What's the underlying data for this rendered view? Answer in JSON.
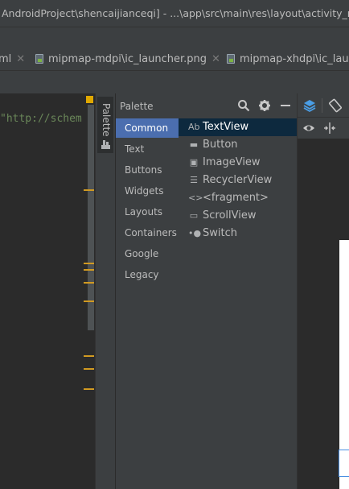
{
  "window": {
    "title": "AndroidProject\\shencaijianceqi] - ...\\app\\src\\main\\res\\layout\\activity_m"
  },
  "tabs": [
    {
      "label": "ml",
      "closable": true
    },
    {
      "label": "mipmap-mdpi\\ic_launcher.png",
      "closable": true
    },
    {
      "label": "mipmap-xhdpi\\ic_launc"
    }
  ],
  "editor": {
    "code_line": "\"http://schem"
  },
  "side_strip": {
    "palette_tab_label": "Palette"
  },
  "palette": {
    "title": "Palette",
    "categories": [
      {
        "label": "Common",
        "selected": true
      },
      {
        "label": "Text"
      },
      {
        "label": "Buttons"
      },
      {
        "label": "Widgets"
      },
      {
        "label": "Layouts"
      },
      {
        "label": "Containers"
      },
      {
        "label": "Google"
      },
      {
        "label": "Legacy"
      }
    ],
    "items": [
      {
        "icon": "Ab",
        "icon_name": "textview-icon",
        "label": "TextView",
        "selected": true
      },
      {
        "icon": "▬",
        "icon_name": "button-icon",
        "label": "Button"
      },
      {
        "icon": "▣",
        "icon_name": "imageview-icon",
        "label": "ImageView"
      },
      {
        "icon": "☰",
        "icon_name": "recyclerview-icon",
        "label": "RecyclerView"
      },
      {
        "icon": "<>",
        "icon_name": "fragment-icon",
        "label": "<fragment>"
      },
      {
        "icon": "▭",
        "icon_name": "scrollview-icon",
        "label": "ScrollView"
      },
      {
        "icon": "•●",
        "icon_name": "switch-icon",
        "label": "Switch"
      }
    ]
  },
  "design": {
    "toolbar_icons": [
      "layers-icon",
      "orientation-icon",
      "eye-icon",
      "constraint-icon"
    ]
  },
  "colors": {
    "selection": "#4b6eaf",
    "item_selected": "#0d293e",
    "warning_mark": "#d19a22"
  }
}
